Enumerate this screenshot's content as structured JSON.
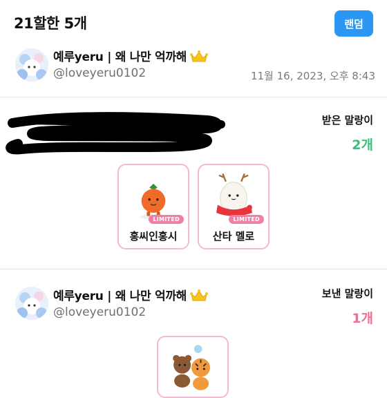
{
  "header": {
    "title": "21할한 5개",
    "random_label": "랜덤"
  },
  "post": {
    "username": "예루yeru | 왜 나만 억까해",
    "handle": "@loveyeru0102",
    "timestamp": "11월 16, 2023, 오후 8:43"
  },
  "received": {
    "label": "받은 말랑이",
    "count": "2개",
    "count_color": "#3cc07a",
    "items": [
      {
        "name": "홍씨인홍시",
        "badge": "LIMITED",
        "icon": "persimmon-character-icon"
      },
      {
        "name": "산타 멜로",
        "badge": "LIMITED",
        "icon": "santa-marshmallow-icon"
      }
    ]
  },
  "sent": {
    "username": "예루yeru | 왜 나만 억까해",
    "handle": "@loveyeru0102",
    "label": "보낸 말랑이",
    "count": "1개",
    "count_color": "#ee6f93",
    "items": [
      {
        "icon": "bear-and-tiger-icon"
      }
    ]
  },
  "colors": {
    "accent": "#2b97f3",
    "card_border": "#f3b9cf",
    "limited_badge": "#f07fa6"
  }
}
